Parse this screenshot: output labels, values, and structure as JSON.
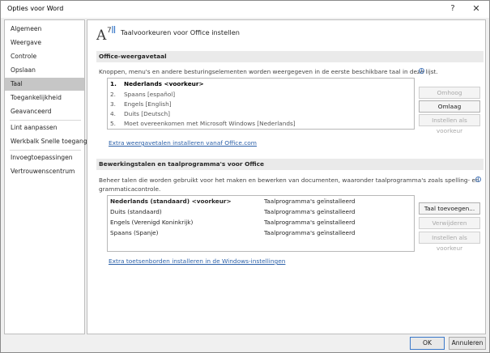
{
  "window": {
    "title": "Opties voor Word",
    "help_glyph": "?",
    "close_glyph": "✕"
  },
  "sidebar": {
    "items": [
      {
        "label": "Algemeen"
      },
      {
        "label": "Weergave"
      },
      {
        "label": "Controle"
      },
      {
        "label": "Opslaan"
      },
      {
        "label": "Taal",
        "active": true
      },
      {
        "label": "Toegankelijkheid"
      },
      {
        "label": "Geavanceerd"
      },
      {
        "label": "Lint aanpassen"
      },
      {
        "label": "Werkbalk Snelle toegang"
      },
      {
        "label": "Invoegtoepassingen"
      },
      {
        "label": "Vertrouwenscentrum"
      }
    ]
  },
  "header": {
    "title": "Taalvoorkeuren voor Office instellen",
    "icon": "language-icon"
  },
  "display_section": {
    "heading": "Office-weergavetaal",
    "description": "Knoppen, menu's en andere besturingselementen worden weergegeven in de eerste beschikbare taal in deze lijst.",
    "languages": [
      {
        "num": "1.",
        "name": "Nederlands <voorkeur>",
        "selected": true
      },
      {
        "num": "2.",
        "name": "Spaans [español]"
      },
      {
        "num": "3.",
        "name": "Engels [English]"
      },
      {
        "num": "4.",
        "name": "Duits [Deutsch]"
      },
      {
        "num": "5.",
        "name": "Moet overeenkomen met Microsoft Windows [Nederlands]"
      }
    ],
    "btn_up": "Omhoog",
    "btn_down": "Omlaag",
    "btn_set_pref": "Instellen als voorkeur",
    "link": "Extra weergavetalen installeren vanaf Office.com"
  },
  "editing_section": {
    "heading": "Bewerkingstalen en taalprogramma's voor Office",
    "description_line1": "Beheer talen die worden gebruikt voor het maken en bewerken van documenten, waaronder taalprogramma's zoals spelling- en",
    "description_line2": "grammaticacontrole.",
    "rows": [
      {
        "language": "Nederlands (standaard) <voorkeur>",
        "status": "Taalprogramma's geïnstalleerd"
      },
      {
        "language": "Duits (standaard)",
        "status": "Taalprogramma's geïnstalleerd"
      },
      {
        "language": "Engels (Verenigd Koninkrijk)",
        "status": "Taalprogramma's geïnstalleerd"
      },
      {
        "language": "Spaans (Spanje)",
        "status": "Taalprogramma's geïnstalleerd"
      }
    ],
    "btn_add": "Taal toevoegen...",
    "btn_remove": "Verwijderen",
    "btn_set_pref": "Instellen als voorkeur",
    "link": "Extra toetsenborden installeren in de Windows-instellingen"
  },
  "footer": {
    "ok": "OK",
    "cancel": "Annuleren"
  },
  "colors": {
    "link": "#2a5fa8",
    "active_nav": "#c6c6c6",
    "ok_border": "#3a78c9"
  }
}
